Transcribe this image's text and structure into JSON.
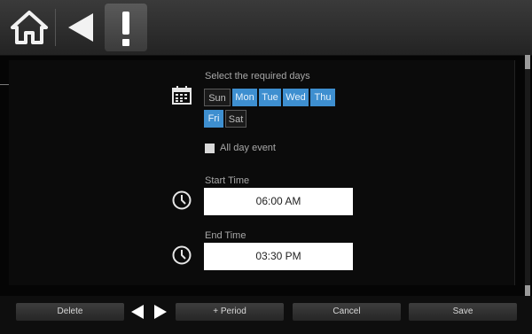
{
  "toolbar": {
    "home_icon": "home-icon",
    "back_icon": "back-arrow-icon",
    "alert_icon": "exclamation-icon"
  },
  "days": {
    "heading": "Select the required days",
    "items": [
      {
        "label": "Sun",
        "selected": false
      },
      {
        "label": "Mon",
        "selected": true
      },
      {
        "label": "Tue",
        "selected": true
      },
      {
        "label": "Wed",
        "selected": true
      },
      {
        "label": "Thu",
        "selected": true
      },
      {
        "label": "Fri",
        "selected": true
      },
      {
        "label": "Sat",
        "selected": false
      }
    ]
  },
  "all_day": {
    "label": "All day event",
    "checked": false
  },
  "start": {
    "label": "Start Time",
    "value": "06:00 AM"
  },
  "end": {
    "label": "End Time",
    "value": "03:30 PM"
  },
  "footer": {
    "delete": "Delete",
    "add_period": "+ Period",
    "cancel": "Cancel",
    "save": "Save"
  },
  "colors": {
    "selected_day": "#3e8fd0",
    "bar": "#2e2e2e"
  }
}
